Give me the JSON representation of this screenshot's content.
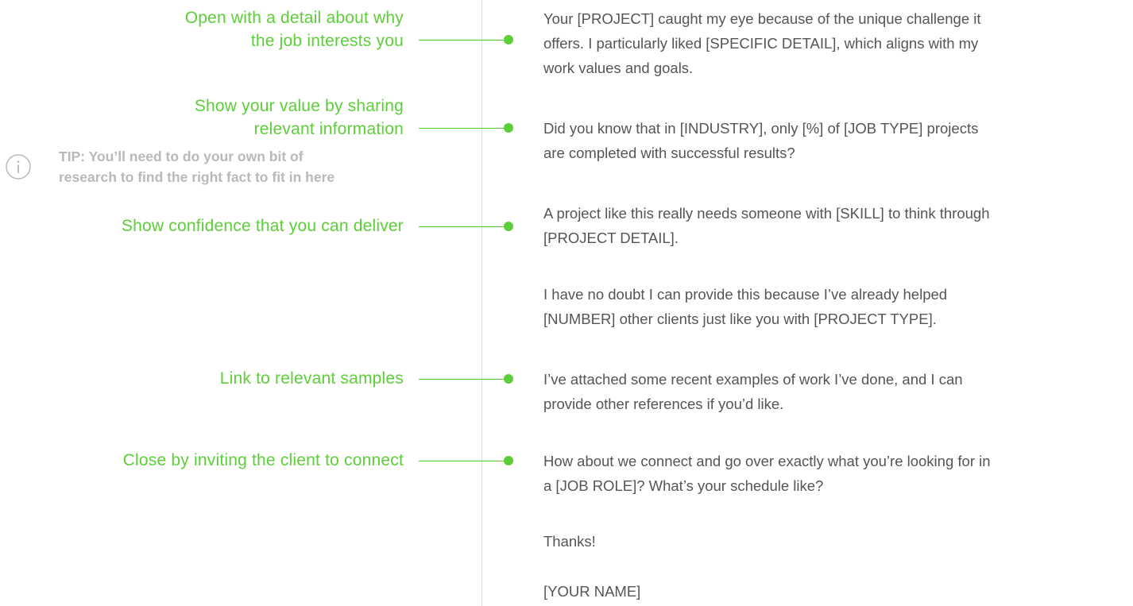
{
  "annotations": {
    "open_line1": "Open with a detail about why",
    "open_line2": "the job interests you",
    "value_line1": "Show your value by sharing",
    "value_line2": "relevant information",
    "confidence": "Show confidence that you can deliver",
    "samples": "Link to relevant samples",
    "close": "Close by inviting the client to connect"
  },
  "tip": {
    "icon": "info-icon",
    "line1": "TIP: You’ll need to do your own bit of",
    "line2": "research to find the right fact to fit in here"
  },
  "letter": {
    "p1_l1": "Your [PROJECT] caught my eye because of the unique challenge it",
    "p1_l2": "offers. I particularly liked [SPECIFIC DETAIL], which aligns with my",
    "p1_l3": "work values and goals.",
    "p2_l1": "Did you know that in [INDUSTRY], only [%] of [JOB TYPE] projects",
    "p2_l2": "are completed with successful results?",
    "p3_l1": "A project like this really needs someone with [SKILL] to think through",
    "p3_l2": "[PROJECT DETAIL].",
    "p4_l1": "I have no doubt I can provide this because I’ve already helped",
    "p4_l2": "[NUMBER] other clients just like you with [PROJECT TYPE].",
    "p5_l1": "I’ve attached some recent examples of work I’ve done, and I can",
    "p5_l2": "provide other references if you’d like.",
    "p6_l1": "How about we connect and go over exactly what you’re looking for in",
    "p6_l2": "a [JOB ROLE]? What’s your schedule like?",
    "thanks": "Thanks!",
    "signature": "[YOUR NAME]"
  },
  "colors": {
    "accent": "#5ccf38",
    "body_text": "#555555",
    "tip_text": "#b9b9b9",
    "divider": "#dcdcdc"
  }
}
